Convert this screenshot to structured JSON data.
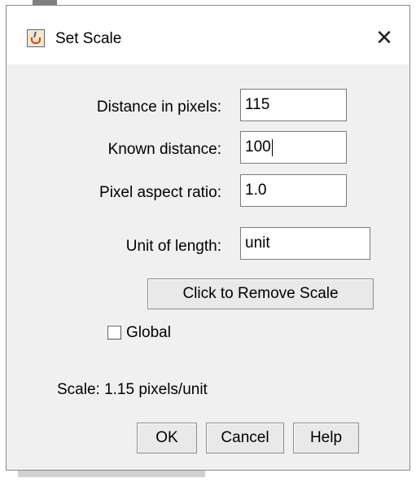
{
  "window": {
    "title": "Set Scale",
    "close_glyph": "✕",
    "icon": "java-app-icon"
  },
  "form": {
    "distance_label": "Distance in pixels:",
    "distance_value": "115",
    "known_label": "Known distance:",
    "known_value": "100",
    "aspect_label": "Pixel aspect ratio:",
    "aspect_value": "1.0",
    "unit_label": "Unit of length:",
    "unit_value": "unit"
  },
  "remove_scale_label": "Click to Remove Scale",
  "global": {
    "label": "Global",
    "checked": false
  },
  "scale_info": "Scale: 1.15 pixels/unit",
  "buttons": {
    "ok": "OK",
    "cancel": "Cancel",
    "help": "Help"
  }
}
